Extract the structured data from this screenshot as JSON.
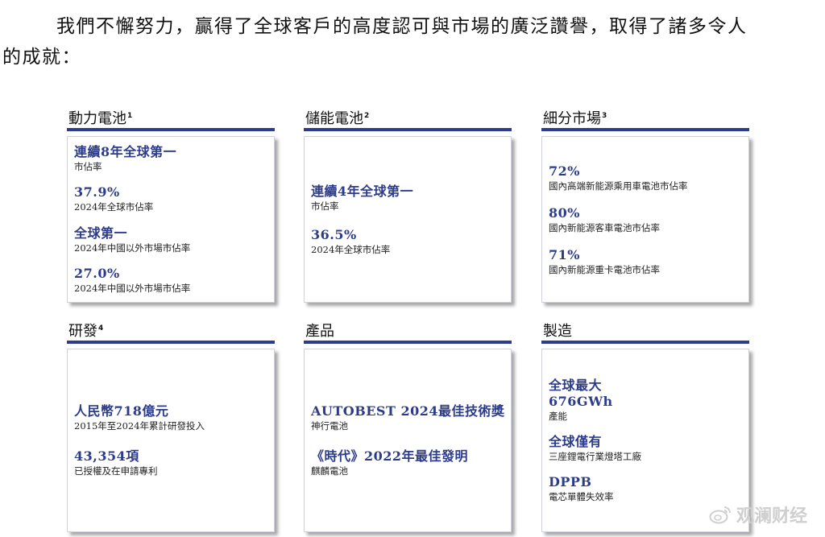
{
  "intro_line1": "我們不懈努力，贏得了全球客戶的高度認可與市場的廣泛讚譽，取得了諸多令人",
  "intro_line2": "矚目的成就：",
  "cards": {
    "power_battery": {
      "title": "動力電池",
      "note": "1",
      "stats": [
        {
          "value": "連續8年全球第一",
          "label": "市佔率"
        },
        {
          "value": "37.9%",
          "label": "2024年全球市佔率"
        },
        {
          "value": "全球第一",
          "label": "2024年中國以外市場市佔率"
        },
        {
          "value": "27.0%",
          "label": "2024年中國以外市場市佔率"
        }
      ]
    },
    "storage_battery": {
      "title": "儲能電池",
      "note": "2",
      "stats": [
        {
          "value": "連續4年全球第一",
          "label": "市佔率"
        },
        {
          "value": "36.5%",
          "label": "2024年全球市佔率"
        }
      ]
    },
    "segment_market": {
      "title": "細分市場",
      "note": "3",
      "stats": [
        {
          "value": "72%",
          "label": "國內高端新能源乘用車電池市佔率"
        },
        {
          "value": "80%",
          "label": "國內新能源客車電池市佔率"
        },
        {
          "value": "71%",
          "label": "國內新能源重卡電池市佔率"
        }
      ]
    },
    "rnd": {
      "title": "研發",
      "note": "4",
      "stats": [
        {
          "value": "人民幣718億元",
          "label": "2015年至2024年累計研發投入"
        },
        {
          "value": "43,354項",
          "label": "已授權及在申請專利"
        }
      ]
    },
    "products": {
      "title": "產品",
      "note": "",
      "stats": [
        {
          "value": "AUTOBEST 2024最佳技術獎",
          "label": "神行電池"
        },
        {
          "value": "《時代》2022年最佳發明",
          "label": "麒麟電池"
        }
      ]
    },
    "manufacturing": {
      "title": "製造",
      "note": "",
      "stats": [
        {
          "value": "全球最大",
          "value2": "676GWh",
          "label": "產能"
        },
        {
          "value": "全球僅有",
          "label": "三座鋰電行業燈塔工廠"
        },
        {
          "value": "DPPB",
          "label": "電芯單體失效率"
        }
      ]
    }
  },
  "watermark_text": "观澜财经",
  "watermark_icon": "weibo-icon",
  "accent_color": "#2c3c8a"
}
